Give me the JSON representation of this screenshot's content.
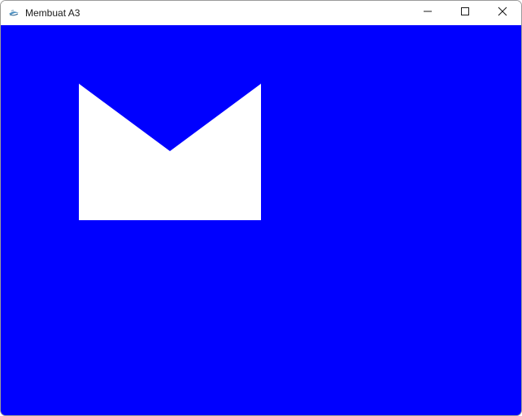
{
  "window": {
    "title": "Membuat A3",
    "app_icon": "java-coffee-cup-icon",
    "controls": {
      "minimize_icon": "minimize-icon",
      "maximize_icon": "maximize-icon",
      "close_icon": "close-icon"
    }
  },
  "canvas": {
    "background_color": "#0000ff",
    "shape": {
      "kind": "envelope-notched-rectangle",
      "fill_color": "#ffffff"
    }
  }
}
